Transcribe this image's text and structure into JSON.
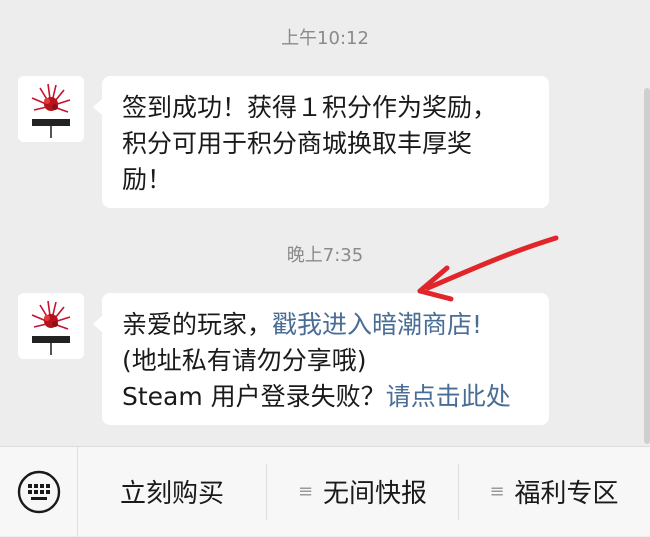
{
  "chat": {
    "messages": [
      {
        "time": "上午10:12",
        "avatar_icon": "game-logo-avatar",
        "lines": [
          "签到成功！获得１积分作为奖励，",
          "积分可用于积分商城换取丰厚奖",
          "励！"
        ]
      },
      {
        "time": "晚上7:35",
        "avatar_icon": "game-logo-avatar",
        "line1_prefix": "亲爱的玩家，",
        "line1_link": "戳我进入暗潮商店!",
        "line2": "(地址私有请勿分享哦)",
        "line3_prefix": "Steam 用户登录失败？",
        "line3_link": "请点击此处"
      }
    ]
  },
  "bottom_menu": {
    "keyboard_icon": "keyboard-icon",
    "items": [
      {
        "label": "立刻购买",
        "icon": ""
      },
      {
        "label": "无间快报",
        "icon": "menu-lines-icon"
      },
      {
        "label": "福利专区",
        "icon": "menu-lines-icon"
      }
    ]
  },
  "colors": {
    "link": "#4a6d96",
    "annotation_arrow": "#e0262a"
  }
}
